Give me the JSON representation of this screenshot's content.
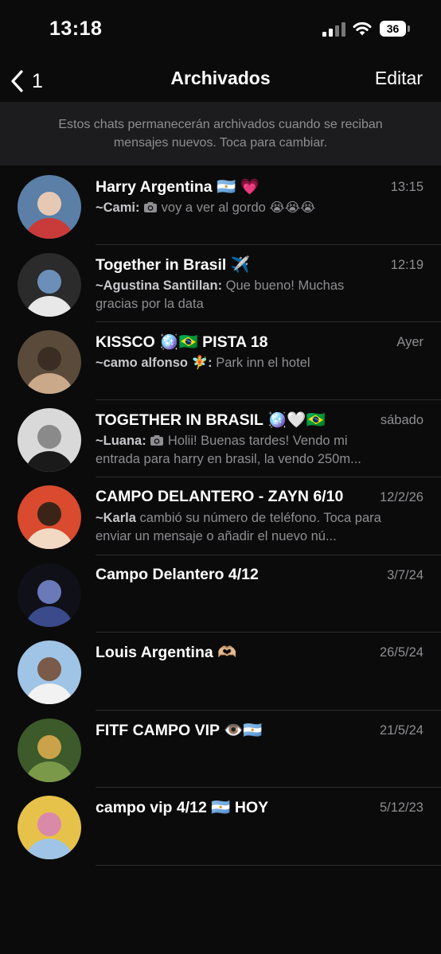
{
  "status": {
    "time": "13:18",
    "battery": "36"
  },
  "nav": {
    "back_count": "1",
    "title": "Archivados",
    "edit_label": "Editar"
  },
  "banner": {
    "line1": "Estos chats permanecerán archivados cuando se reciban",
    "line2": "mensajes nuevos. Toca para cambiar."
  },
  "chats": [
    {
      "title": "Harry Argentina 🇦🇷 💗",
      "time": "13:15",
      "sender": "~Cami:",
      "has_photo": true,
      "preview": "voy a ver al gordo 😭😭😭",
      "colors": [
        "#5b7fa6",
        "#c93a3a",
        "#e6c9b5"
      ]
    },
    {
      "title": "Together in Brasil ✈️",
      "time": "12:19",
      "sender": "~Agustina Santillan:",
      "has_photo": false,
      "preview": "Que bueno! Muchas gracias por la data",
      "colors": [
        "#2b2b2b",
        "#e8e8e8",
        "#6b8fb8"
      ]
    },
    {
      "title": "KISSCO 🪩🇧🇷 PISTA 18",
      "time": "Ayer",
      "sender": "~camo alfonso 🧚:",
      "has_photo": false,
      "preview": "Park inn el hotel",
      "colors": [
        "#5a4a3a",
        "#c9a98a",
        "#3a2e24"
      ]
    },
    {
      "title": "TOGETHER IN BRASIL 🪩🤍🇧🇷",
      "time": "sábado",
      "sender": "~Luana:",
      "has_photo": true,
      "preview": "Holii! Buenas tardes! Vendo mi entrada para harry en brasil, la vendo 250m...",
      "colors": [
        "#d9d9d9",
        "#1a1a1a",
        "#8a8a8a"
      ]
    },
    {
      "title": "CAMPO DELANTERO - ZAYN 6/10",
      "time": "12/2/26",
      "sender": "~Karla",
      "has_photo": false,
      "preview": "cambió su número de teléfono. Toca para enviar un mensaje o añadir el nuevo nú...",
      "colors": [
        "#d94a2e",
        "#f2d9c4",
        "#3a2418"
      ]
    },
    {
      "title": "Campo Delantero 4/12",
      "time": "3/7/24",
      "sender": "",
      "has_photo": false,
      "preview": "",
      "colors": [
        "#101018",
        "#3a4a8a",
        "#6a7ab8"
      ]
    },
    {
      "title": "Louis Argentina 🫶🏼",
      "time": "26/5/24",
      "sender": "",
      "has_photo": false,
      "preview": "",
      "colors": [
        "#9fc4e6",
        "#f2f2f2",
        "#7a5a48"
      ]
    },
    {
      "title": "FITF CAMPO VIP 👁️🇦🇷",
      "time": "21/5/24",
      "sender": "",
      "has_photo": false,
      "preview": "",
      "colors": [
        "#3c5a2a",
        "#7a9a4a",
        "#c9a24a"
      ]
    },
    {
      "title": "campo vip 4/12 🇦🇷 HOY",
      "time": "5/12/23",
      "sender": "",
      "has_photo": false,
      "preview": "",
      "colors": [
        "#e6c24a",
        "#9fc4e6",
        "#d98aa8"
      ]
    }
  ]
}
